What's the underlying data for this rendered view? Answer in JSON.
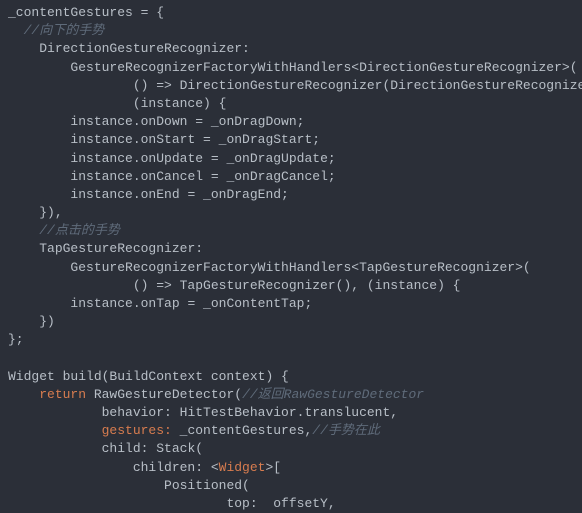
{
  "code": {
    "lines": [
      {
        "indent": 0,
        "segments": [
          {
            "text": "_contentGestures = {",
            "cls": "default"
          }
        ]
      },
      {
        "indent": 1,
        "segments": [
          {
            "text": "//向下的手势",
            "cls": "comment"
          }
        ]
      },
      {
        "indent": 2,
        "segments": [
          {
            "text": "DirectionGestureRecognizer:",
            "cls": "default"
          }
        ]
      },
      {
        "indent": 4,
        "segments": [
          {
            "text": "GestureRecognizerFactoryWithHandlers<DirectionGestureRecognizer>(",
            "cls": "default"
          }
        ]
      },
      {
        "indent": 8,
        "segments": [
          {
            "text": "() => DirectionGestureRecognizer(DirectionGestureRecognizer.down),",
            "cls": "default"
          }
        ]
      },
      {
        "indent": 8,
        "segments": [
          {
            "text": "(instance) {",
            "cls": "default"
          }
        ]
      },
      {
        "indent": 4,
        "segments": [
          {
            "text": "instance.onDown = _onDragDown;",
            "cls": "default"
          }
        ]
      },
      {
        "indent": 4,
        "segments": [
          {
            "text": "instance.onStart = _onDragStart;",
            "cls": "default"
          }
        ]
      },
      {
        "indent": 4,
        "segments": [
          {
            "text": "instance.onUpdate = _onDragUpdate;",
            "cls": "default"
          }
        ]
      },
      {
        "indent": 4,
        "segments": [
          {
            "text": "instance.onCancel = _onDragCancel;",
            "cls": "default"
          }
        ]
      },
      {
        "indent": 4,
        "segments": [
          {
            "text": "instance.onEnd = _onDragEnd;",
            "cls": "default"
          }
        ]
      },
      {
        "indent": 2,
        "segments": [
          {
            "text": "}),",
            "cls": "default"
          }
        ]
      },
      {
        "indent": 2,
        "segments": [
          {
            "text": "//点击的手势",
            "cls": "comment"
          }
        ]
      },
      {
        "indent": 2,
        "segments": [
          {
            "text": "TapGestureRecognizer:",
            "cls": "default"
          }
        ]
      },
      {
        "indent": 4,
        "segments": [
          {
            "text": "GestureRecognizerFactoryWithHandlers<TapGestureRecognizer>(",
            "cls": "default"
          }
        ]
      },
      {
        "indent": 8,
        "segments": [
          {
            "text": "() => TapGestureRecognizer(), (instance) {",
            "cls": "default"
          }
        ]
      },
      {
        "indent": 4,
        "segments": [
          {
            "text": "instance.onTap = _onContentTap;",
            "cls": "default"
          }
        ]
      },
      {
        "indent": 2,
        "segments": [
          {
            "text": "})",
            "cls": "default"
          }
        ]
      },
      {
        "indent": 0,
        "segments": [
          {
            "text": "};",
            "cls": "default"
          }
        ]
      },
      {
        "indent": 0,
        "segments": [
          {
            "text": "",
            "cls": "default"
          }
        ]
      },
      {
        "indent": 0,
        "segments": [
          {
            "text": "Widget build(BuildContext context) {",
            "cls": "default"
          }
        ]
      },
      {
        "indent": 2,
        "segments": [
          {
            "text": "return",
            "cls": "keyword"
          },
          {
            "text": " RawGestureDetector(",
            "cls": "default"
          },
          {
            "text": "//返回RawGestureDetector",
            "cls": "comment"
          }
        ]
      },
      {
        "indent": 6,
        "segments": [
          {
            "text": "behavior: HitTestBehavior.translucent,",
            "cls": "default"
          }
        ]
      },
      {
        "indent": 6,
        "segments": [
          {
            "text": "gestures:",
            "cls": "param-name"
          },
          {
            "text": " _contentGestures,",
            "cls": "default"
          },
          {
            "text": "//手势在此",
            "cls": "comment"
          }
        ]
      },
      {
        "indent": 6,
        "segments": [
          {
            "text": "child: Stack(",
            "cls": "default"
          }
        ]
      },
      {
        "indent": 8,
        "segments": [
          {
            "text": "children: <",
            "cls": "default"
          },
          {
            "text": "Widget",
            "cls": "widget-hl"
          },
          {
            "text": ">[",
            "cls": "default"
          }
        ]
      },
      {
        "indent": 10,
        "segments": [
          {
            "text": "Positioned(",
            "cls": "default"
          }
        ]
      },
      {
        "indent": 14,
        "segments": [
          {
            "text": "top:  offsetY,",
            "cls": "default"
          }
        ]
      }
    ]
  }
}
